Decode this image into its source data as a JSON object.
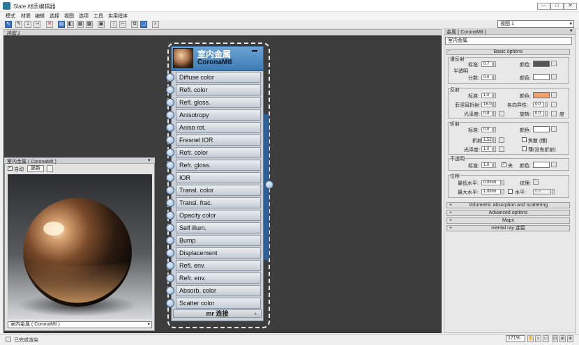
{
  "window": {
    "title": "Slate 材质编辑器",
    "min": "—",
    "max": "□",
    "close": "✕"
  },
  "menu": [
    "模式",
    "材质",
    "编辑",
    "选择",
    "视图",
    "选项",
    "工具",
    "实用程序"
  ],
  "view_select": "视图 1",
  "canvas_tab": "排图 1",
  "node": {
    "title": "室内金属",
    "type": "CoronaMtl",
    "slots": [
      "Diffuse color",
      "Refl. color",
      "Refl. gloss.",
      "Anisotropy",
      "Aniso rot.",
      "Fresnel IOR",
      "Refr. color",
      "Refr. gloss.",
      "IOR",
      "Transl. color",
      "Transl. frac.",
      "Opacity color",
      "Self illum.",
      "Bump",
      "Displacement",
      "Refl. env.",
      "Refr. env.",
      "Absorb. color",
      "Scatter color"
    ],
    "footer": "mr 连接"
  },
  "preview": {
    "title": "室内金属 ( CoronaMtl )",
    "auto_label": "自动",
    "update_label": "更新",
    "selector": "室内金属 ( CoronaMtl )"
  },
  "status": {
    "text": "已完成渲染",
    "zoom": "171%"
  },
  "panel": {
    "title": "金属 ( CoronaMtl )",
    "mat_name": "室内金属",
    "basic_options": "Basic options",
    "diffuse": {
      "group": "漫反射",
      "level_label": "标准:",
      "level": "0.7",
      "color_label": "颜色:",
      "translucency": "半透明",
      "fraction_label": "分数:",
      "fraction": "0.0",
      "color2_label": "颜色:"
    },
    "reflection": {
      "group": "反射",
      "level_label": "标准:",
      "level": "1.0",
      "color_label": "颜色:",
      "fresnel_label": "菲涅耳折射:",
      "fresnel": "15.0",
      "aniso_label": "各向异性:",
      "aniso": "0.0",
      "gloss_label": "光泽度:",
      "gloss": "0.8",
      "rot_label": "旋转:",
      "rot": "0.0",
      "deg": "度"
    },
    "refraction": {
      "group": "折射",
      "level_label": "标准:",
      "level": "0.0",
      "color_label": "颜色:",
      "ior_label": "折射",
      "ior": "1.52",
      "caustics": "焦散 (慢)",
      "gloss_label": "光泽度:",
      "gloss": "1.0",
      "thin": "薄(没有折射)"
    },
    "opacity": {
      "group": "不透明",
      "level_label": "标准:",
      "level": "1.0",
      "clip": "夹",
      "color_label": "颜色:"
    },
    "displacement": {
      "group": "位移",
      "min_label": "最低水平:",
      "min": "0.0mm",
      "tex_label": "纹理:",
      "max_label": "最大水平:",
      "max": "1.0mm",
      "water_label": "水平:",
      "water": "0.5"
    },
    "rollouts": [
      "Volumetric absorption and scattering",
      "Advanced options",
      "Maps",
      "mental ray 连接"
    ]
  },
  "colors": {
    "diffuse_swatch": "#555555",
    "reflect_swatch": "#f4a068",
    "white_swatch": "#ffffff",
    "node_header": "#4a87bf"
  }
}
